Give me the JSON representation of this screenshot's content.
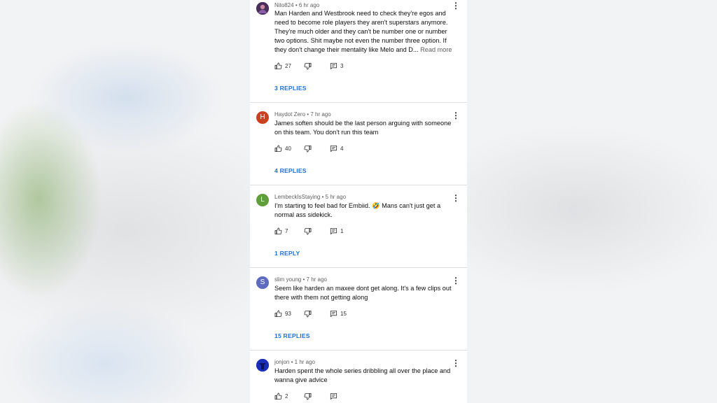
{
  "comments": [
    {
      "avatar_letter": "",
      "avatar_color": "#5a3d6e",
      "username": "Nito824",
      "time": "6 hr ago",
      "text": "Man Harden and Westbrook need to check they're egos and need to become role players they aren't superstars anymore. They're much older and they can't be number one or number two options. Shit maybe not even the number three option. If they don't change their mentality like Melo and D...",
      "read_more": "Read more",
      "likes": "27",
      "reply_count": "3",
      "replies_label": "3 REPLIES"
    },
    {
      "avatar_letter": "H",
      "avatar_color": "#c9421f",
      "username": "Haydot Zero",
      "time": "7 hr ago",
      "text": "James soften should be the last person arguing with someone on this team. You don't run this team",
      "likes": "40",
      "reply_count": "4",
      "replies_label": "4 REPLIES"
    },
    {
      "avatar_letter": "L",
      "avatar_color": "#5f9e3a",
      "username": "LembeckIsStaying",
      "time": "5 hr ago",
      "text": "I'm starting to feel bad for Embiid. 🤣 Mans can't just get a normal ass sidekick.",
      "likes": "7",
      "reply_count": "1",
      "replies_label": "1 REPLY"
    },
    {
      "avatar_letter": "S",
      "avatar_color": "#5c6bc0",
      "username": "slim young",
      "time": "7 hr ago",
      "text": "Seem like harden an maxee dont get along. It's a few clips out there with them not getting along",
      "likes": "93",
      "reply_count": "15",
      "replies_label": "15 REPLIES"
    },
    {
      "avatar_letter": "",
      "avatar_color": "#1a2fb8",
      "username": "jonjon",
      "time": "1 hr ago",
      "text": "Harden spent the whole series dribbling all over the place and wanna give advice",
      "likes": "2",
      "reply_count": "",
      "replies_label": ""
    }
  ],
  "meta_separator": "•"
}
